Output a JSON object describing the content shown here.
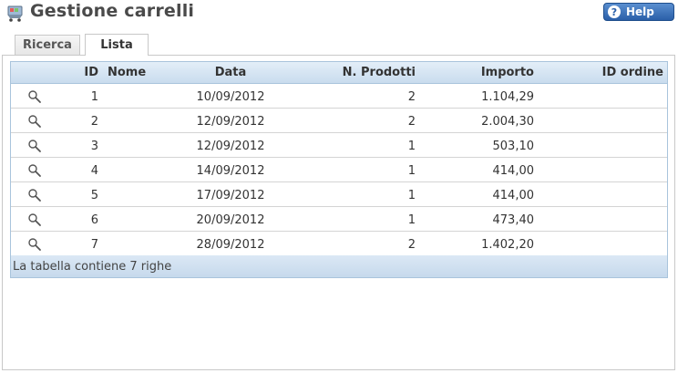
{
  "header": {
    "app_icon": "shopping-cart-icon",
    "title": "Gestione carrelli",
    "help_label": "Help",
    "help_icon": "question-icon"
  },
  "tabs": [
    {
      "label": "Ricerca",
      "active": false
    },
    {
      "label": "Lista",
      "active": true
    }
  ],
  "table": {
    "columns": [
      "",
      "ID",
      "Nome",
      "Data",
      "N. Prodotti",
      "Importo",
      "ID ordine"
    ],
    "row_icon": "magnifier-icon",
    "rows": [
      {
        "id": "1",
        "nome": "",
        "data": "10/09/2012",
        "n_prodotti": "2",
        "importo": "1.104,29",
        "id_ordine": ""
      },
      {
        "id": "2",
        "nome": "",
        "data": "12/09/2012",
        "n_prodotti": "2",
        "importo": "2.004,30",
        "id_ordine": ""
      },
      {
        "id": "3",
        "nome": "",
        "data": "12/09/2012",
        "n_prodotti": "1",
        "importo": "503,10",
        "id_ordine": ""
      },
      {
        "id": "4",
        "nome": "",
        "data": "14/09/2012",
        "n_prodotti": "1",
        "importo": "414,00",
        "id_ordine": ""
      },
      {
        "id": "5",
        "nome": "",
        "data": "17/09/2012",
        "n_prodotti": "1",
        "importo": "414,00",
        "id_ordine": ""
      },
      {
        "id": "6",
        "nome": "",
        "data": "20/09/2012",
        "n_prodotti": "1",
        "importo": "473,40",
        "id_ordine": ""
      },
      {
        "id": "7",
        "nome": "",
        "data": "28/09/2012",
        "n_prodotti": "2",
        "importo": "1.402,20",
        "id_ordine": ""
      }
    ],
    "footer": "La tabella contiene 7 righe"
  },
  "colors": {
    "accent": "#2a5fa8",
    "grid_header": "#c9dcee"
  }
}
